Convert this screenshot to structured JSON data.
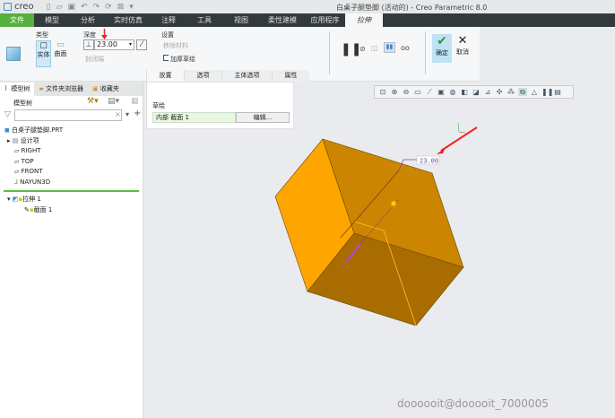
{
  "window": {
    "app": "creo",
    "title": "白桌子腿垫脚 (活动的) - Creo Parametric 8.0"
  },
  "menu": [
    "文件",
    "模型",
    "分析",
    "实时仿真",
    "注释",
    "工具",
    "视图",
    "柔性建模",
    "应用程序",
    "拉伸"
  ],
  "ribbon": {
    "type_label": "类型",
    "solid": "实体",
    "surface": "曲面",
    "depth_label": "深度",
    "depth_value": "23.00",
    "close_ends": "封闭端",
    "settings_label": "设置",
    "remove_material": "移除材料",
    "thicken_sketch": "加厚草绘",
    "ok": "确定",
    "cancel": "取消"
  },
  "subtabs": [
    "放置",
    "选项",
    "主体选项",
    "属性"
  ],
  "placement": {
    "sketch_label": "草绘",
    "sketch_value": "内部 截面 1",
    "edit_button": "编辑..."
  },
  "left_tabs": [
    "模型树",
    "文件夹浏览器",
    "收藏夹"
  ],
  "tree": {
    "header": "模型树",
    "search_placeholder": "",
    "items": [
      "白桌子腿垫脚.PRT",
      "设计项",
      "RIGHT",
      "TOP",
      "FRONT",
      "NAYUN3D"
    ],
    "features": [
      "拉伸 1",
      "截面 1"
    ]
  },
  "viewport": {
    "dimension": "23.00",
    "colors": {
      "face_light": "#FFA500",
      "face_top": "#CC8500",
      "face_bottom": "#A86C00"
    }
  },
  "watermark": "doooooit@dooooit_7000005",
  "colors": {
    "file_tab": "#55b03c",
    "menubar": "#333a3d",
    "tree_divider": "#55c040"
  }
}
